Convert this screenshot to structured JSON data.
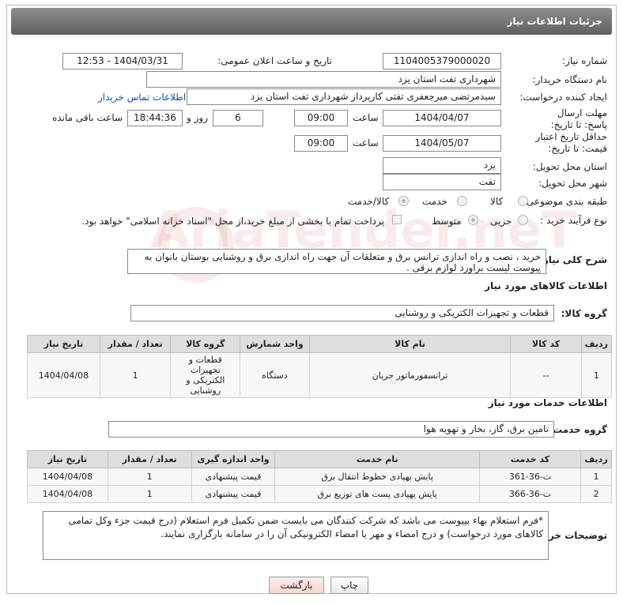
{
  "header": {
    "title": "جزئیات اطلاعات نیاز"
  },
  "form": {
    "need_number_label": "شماره نیاز:",
    "need_number": "1104005379000020",
    "announce_label": "تاریخ و ساعت اعلان عمومی:",
    "announce_value": "1404/03/31 - 12:53",
    "buyer_org_label": "نام دستگاه خریدار:",
    "buyer_org": "شهرداری تفت استان یزد",
    "creator_label": "ایجاد کننده درخواست:",
    "creator": "سیدمرتضی میرجعفری تفتی کارپرداز شهرداری تفت استان یزد",
    "contact_link": "اطلاعات تماس خریدار",
    "reply_deadline_label": "مهلت ارسال پاسخ: تا تاریخ:",
    "reply_date": "1404/04/07",
    "time_label": "ساعت",
    "reply_time": "09:00",
    "days_value": "6",
    "days_label": "روز و",
    "countdown": "18:44:36",
    "remaining_label": "ساعت باقی مانده",
    "price_deadline_label": "حداقل تاریخ اعتبار قیمت: تا تاریخ:",
    "price_date": "1404/05/07",
    "price_time": "09:00",
    "province_label": "استان محل تحویل:",
    "province": "یزد",
    "city_label": "شهر محل تحویل:",
    "city": "تفت",
    "category_label": "طبقه بندی موضوعی:",
    "category_options": [
      "کالا",
      "خدمت",
      "کالا/خدمت"
    ],
    "process_label": "نوع فرآیند خرید :",
    "process_options": [
      "جزیی",
      "متوسط"
    ],
    "payment_note": "پرداخت تمام یا بخشی از مبلغ خرید،از محل \"اسناد خزانه اسلامی\" خواهد بود.",
    "description_label": "شرح کلی نیاز:",
    "description": "خرید ، نصب و راه اندازی ترانس برق و متعلقات آن جهت راه اندازی برق و روشنایی بوستان بانوان به پیوست لیست براورد لوازم برقی ."
  },
  "goods": {
    "section_title": "اطلاعات کالاهای مورد نیاز",
    "group_label": "گروه کالا:",
    "group_value": "قطعات و تجهیزات الکتریکی و روشنایی",
    "columns": [
      "ردیف",
      "کد کالا",
      "نام کالا",
      "واحد شمارش",
      "گروه کالا",
      "تعداد / مقدار",
      "تاریخ نیاز"
    ],
    "rows": [
      {
        "row": "1",
        "code": "--",
        "name": "ترانسفورماتور جریان",
        "unit": "دستگاه",
        "group": "قطعات و تجهیزات الکتریکی و روشنایی",
        "qty": "1",
        "date": "1404/04/08"
      }
    ]
  },
  "services": {
    "section_title": "اطلاعات خدمات مورد نیاز",
    "group_label": "گروه خدمت:",
    "group_value": "تامین برق، گاز، بخار و تهویه هوا",
    "columns": [
      "ردیف",
      "کد خدمت",
      "نام خدمت",
      "واحد اندازه گیری",
      "تعداد / مقدار",
      "تاریخ نیاز"
    ],
    "rows": [
      {
        "row": "1",
        "code": "ت-36-361",
        "name": "پایش پهپادی خطوط انتقال برق",
        "unit": "قیمت پیشنهادی",
        "qty": "1",
        "date": "1404/04/08"
      },
      {
        "row": "2",
        "code": "ت-36-366",
        "name": "پایش پهپادی پست های توزیع برق",
        "unit": "قیمت پیشنهادی",
        "qty": "1",
        "date": "1404/04/08"
      }
    ]
  },
  "notes": {
    "label": "توضیحات خریدار:",
    "text": "*فرم استعلام بهاء بپیوست می باشد که شرکت کنندگان می بایست ضمن تکمیل فرم استعلام (درج قیمت جزء وکل تمامی کالاهای مورد درخواست) و درج امضاء و مهر یا امضاء الکترونیکی آن را در سامانه بارگزاری نمایند."
  },
  "buttons": {
    "print": "چاپ",
    "back": "بازگشت"
  },
  "colors": {
    "header_bg": "#6f6f6f",
    "link": "#0a4fb0",
    "back_button": "#f6d4d4"
  }
}
